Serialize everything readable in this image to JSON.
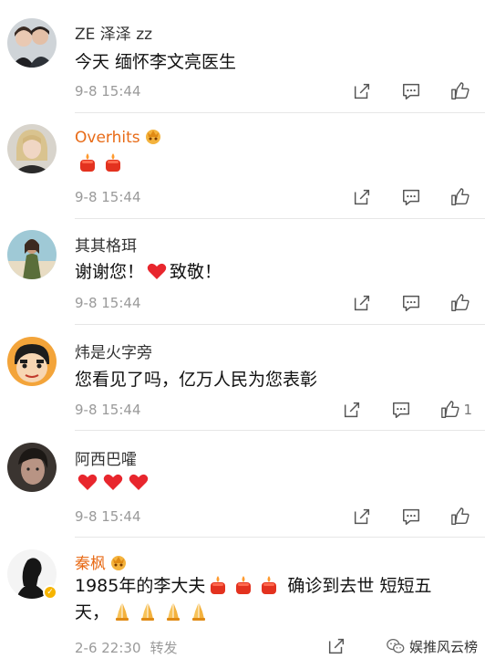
{
  "comments": [
    {
      "username": "ZE 泽泽 zz",
      "vip": false,
      "text_segments": [
        {
          "type": "text",
          "value": "今天 缅怀李文亮医生"
        }
      ],
      "timestamp": "9-8 15:44",
      "likes": ""
    },
    {
      "username": "Overhits",
      "vip": true,
      "text_segments": [
        {
          "type": "emoji",
          "value": "candle"
        },
        {
          "type": "emoji",
          "value": "candle"
        }
      ],
      "timestamp": "9-8 15:44",
      "likes": ""
    },
    {
      "username": "其其格珥",
      "vip": false,
      "text_segments": [
        {
          "type": "text",
          "value": "谢谢您！"
        },
        {
          "type": "emoji",
          "value": "heart"
        },
        {
          "type": "text",
          "value": "致敬！"
        }
      ],
      "timestamp": "9-8 15:44",
      "likes": ""
    },
    {
      "username": "炜是火字旁",
      "vip": false,
      "text_segments": [
        {
          "type": "text",
          "value": "您看见了吗，亿万人民为您表彰"
        }
      ],
      "timestamp": "9-8 15:44",
      "likes": "1"
    },
    {
      "username": "阿西巴嚯",
      "vip": false,
      "text_segments": [
        {
          "type": "emoji",
          "value": "heart"
        },
        {
          "type": "emoji",
          "value": "heart"
        },
        {
          "type": "emoji",
          "value": "heart"
        }
      ],
      "timestamp": "9-8 15:44",
      "likes": ""
    },
    {
      "username": "秦枫",
      "vip": true,
      "verified": true,
      "text_line1": [
        {
          "type": "text",
          "value": "1985年的李大夫"
        },
        {
          "type": "emoji",
          "value": "candle"
        },
        {
          "type": "emoji",
          "value": "candle"
        },
        {
          "type": "emoji",
          "value": "candle"
        },
        {
          "type": "text",
          "value": " 确诊到去世 短短五"
        }
      ],
      "text_line2": [
        {
          "type": "text",
          "value": "天，"
        },
        {
          "type": "emoji",
          "value": "pray"
        },
        {
          "type": "emoji",
          "value": "pray"
        },
        {
          "type": "emoji",
          "value": "pray"
        },
        {
          "type": "emoji",
          "value": "pray"
        }
      ],
      "timestamp": "2-6 22:30",
      "repost_label": "转发",
      "likes": ""
    }
  ],
  "icons": {
    "share": "share-icon",
    "comment": "comment-icon",
    "like": "thumbs-up-icon"
  },
  "watermark": {
    "text": "娱推风云榜",
    "icon": "wechat-icon"
  },
  "colors": {
    "vip_name": "#e86b17",
    "meta": "#9a9a9a",
    "separator": "#e6e6e6"
  }
}
